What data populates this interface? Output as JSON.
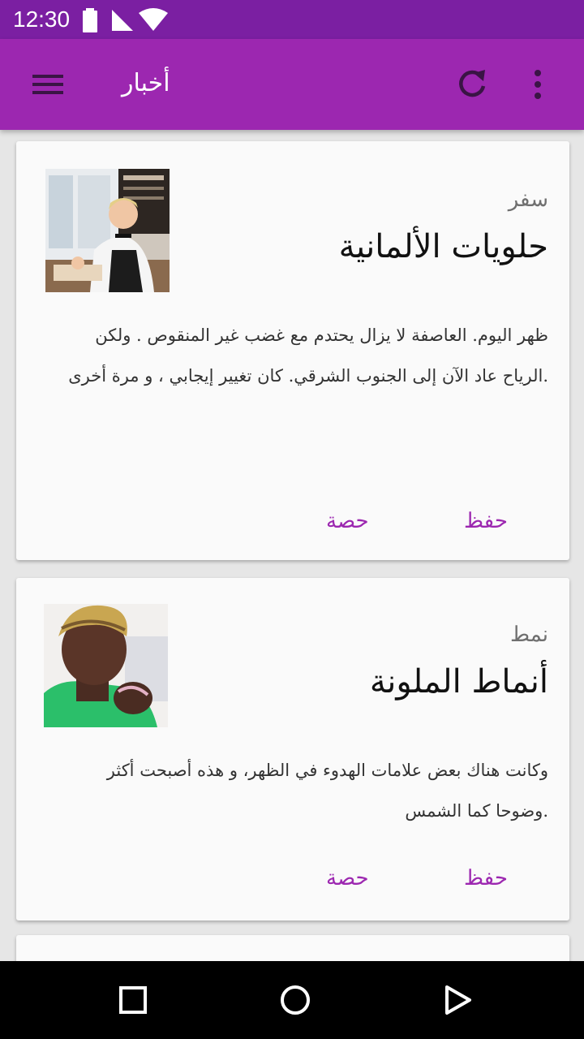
{
  "status_bar": {
    "time": "12:30"
  },
  "app_bar": {
    "title": "أخبار"
  },
  "icons": {
    "menu": "hamburger-menu-icon",
    "refresh": "refresh-icon",
    "more": "more-vert-icon",
    "nav_back": "back-triangle-icon",
    "nav_home": "home-circle-icon",
    "nav_recent": "recent-apps-square-icon"
  },
  "colors": {
    "status_bar": "#7b1fa2",
    "app_bar": "#9c27b0",
    "accent": "#9c27b0",
    "card": "#fafafa",
    "background": "#e6e6e6"
  },
  "cards": [
    {
      "category": "سفر",
      "title": "حلويات الألمانية",
      "body_lines": [
        "ظهر اليوم. العاصفة لا يزال يحتدم مع غضب غير المنقوص . ولكن",
        ".الرياح عاد الآن إلى الجنوب الشرقي. كان تغيير إيجابي ، و  مرة أخرى"
      ],
      "save_label": "حفظ",
      "share_label": "حصة"
    },
    {
      "category": "نمط",
      "title": "أنماط الملونة",
      "body_lines": [
        "وكانت هناك بعض علامات الهدوء في الظهر، و هذه أصبحت أكثر",
        ".وضوحا كما الشمس"
      ],
      "save_label": "حفظ",
      "share_label": "حصة"
    }
  ]
}
